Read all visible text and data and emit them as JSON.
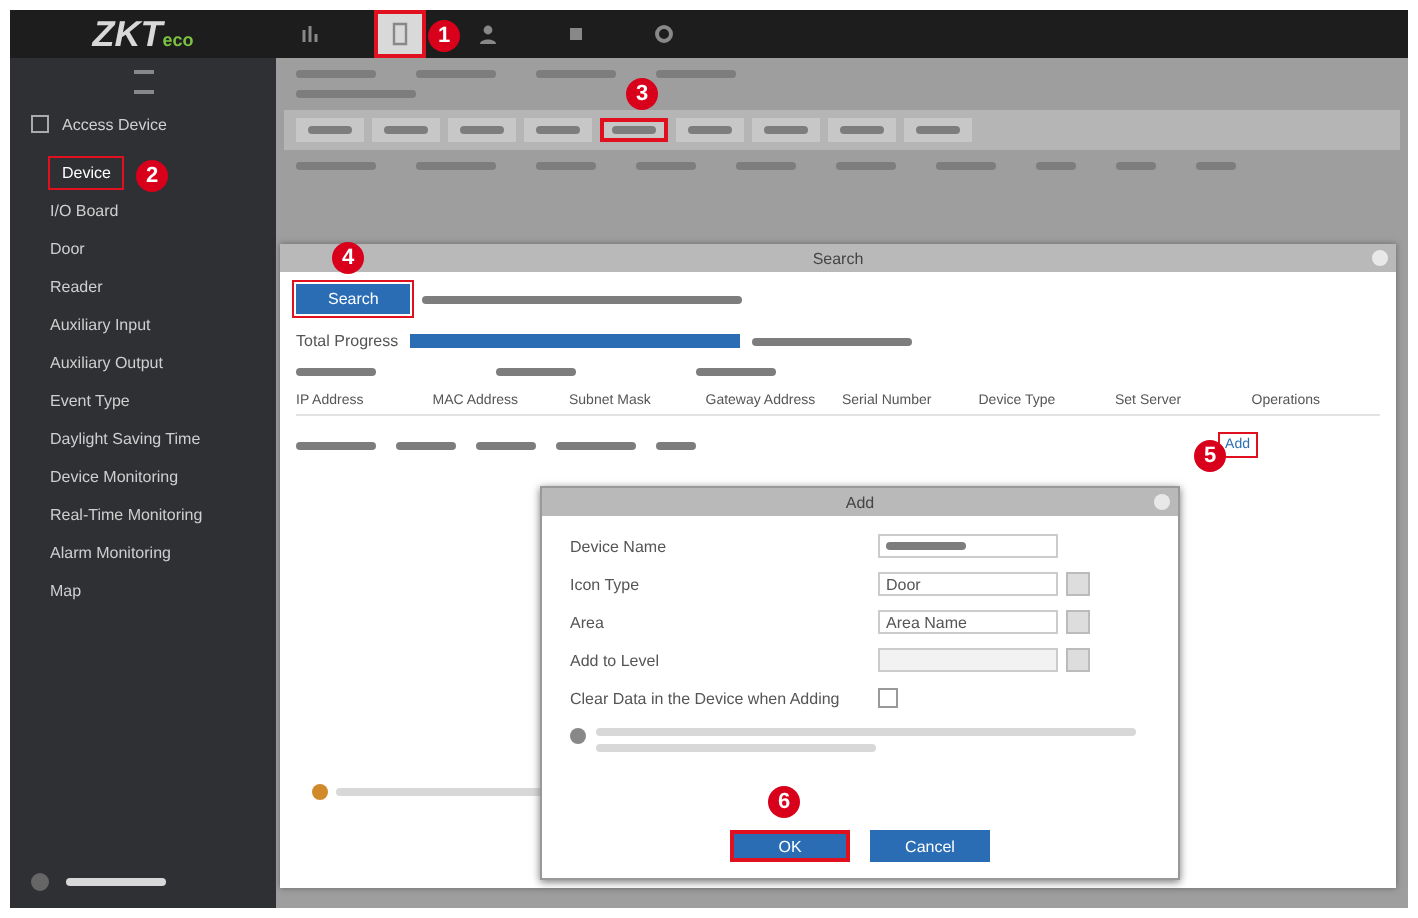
{
  "logo": {
    "main": "ZKT",
    "sub": "eco"
  },
  "top_tabs": [
    {
      "kind": "chart",
      "selected": false
    },
    {
      "kind": "door",
      "selected": true
    },
    {
      "kind": "people",
      "selected": false
    },
    {
      "kind": "square",
      "selected": false
    },
    {
      "kind": "gear",
      "selected": false
    }
  ],
  "sidebar": {
    "section": "Access Device",
    "items": [
      {
        "label": "Device",
        "selected": true
      },
      {
        "label": "I/O Board",
        "selected": false
      },
      {
        "label": "Door",
        "selected": false
      },
      {
        "label": "Reader",
        "selected": false
      },
      {
        "label": "Auxiliary Input",
        "selected": false
      },
      {
        "label": "Auxiliary Output",
        "selected": false
      },
      {
        "label": "Event Type",
        "selected": false
      },
      {
        "label": "Daylight Saving Time",
        "selected": false
      },
      {
        "label": "Device Monitoring",
        "selected": false
      },
      {
        "label": "Real-Time Monitoring",
        "selected": false
      },
      {
        "label": "Alarm Monitoring",
        "selected": false
      },
      {
        "label": "Map",
        "selected": false
      }
    ]
  },
  "toolbar": [
    {
      "highlighted": false
    },
    {
      "highlighted": false
    },
    {
      "highlighted": false
    },
    {
      "highlighted": false
    },
    {
      "highlighted": true
    },
    {
      "highlighted": false
    },
    {
      "highlighted": false
    },
    {
      "highlighted": false
    },
    {
      "highlighted": false
    }
  ],
  "search_dialog": {
    "title": "Search",
    "search_button": "Search",
    "progress_label": "Total Progress",
    "level": 1,
    "columns": [
      "IP Address",
      "MAC Address",
      "Subnet Mask",
      "Gateway Address",
      "Serial Number",
      "Device Type",
      "Set Server",
      "Operations"
    ],
    "row_operation": "Add"
  },
  "add_dialog": {
    "title": "Add",
    "fields": [
      {
        "label": "Device Name",
        "kind": "text"
      },
      {
        "label": "Icon Type",
        "kind": "select",
        "value": "Door"
      },
      {
        "label": "Area",
        "kind": "select",
        "value": "Area Name"
      },
      {
        "label": "Add to Level",
        "kind": "select",
        "disabled": true
      },
      {
        "label": "Clear Data in the Device when Adding",
        "kind": "checkbox",
        "checked": false
      }
    ],
    "buttons": [
      {
        "label": "OK",
        "highlighted": true
      },
      {
        "label": "Cancel",
        "highlighted": false
      }
    ]
  },
  "markers": [
    "1",
    "2",
    "3",
    "4",
    "5",
    "6"
  ]
}
